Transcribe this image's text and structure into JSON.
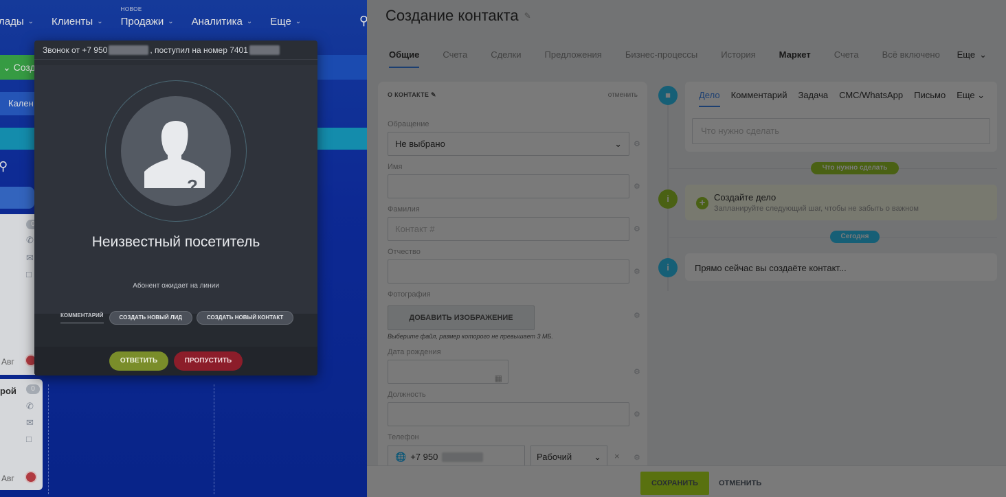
{
  "left_crm": {
    "nav": [
      {
        "label": "лады",
        "badge": ""
      },
      {
        "label": "Клиенты",
        "badge": ""
      },
      {
        "label": "Продажи",
        "badge": "НОВОЕ"
      },
      {
        "label": "Аналитика",
        "badge": ""
      },
      {
        "label": "Еще",
        "badge": ""
      }
    ],
    "create_button": "Созда",
    "calendar_button": "Кален",
    "cards": [
      {
        "count": "0",
        "date": "Авг",
        "name": ""
      },
      {
        "count": "0",
        "date": "Авг",
        "name": "рой"
      }
    ]
  },
  "call_popup": {
    "header_prefix": "Звонок от +7 950",
    "header_middle": ", поступил на номер 7401",
    "visitor_name": "Неизвестный посетитель",
    "waiting_text": "Абонент ожидает на линии",
    "comment_tab": "КОММЕНТАРИЙ",
    "new_lead_button": "СОЗДАТЬ НОВЫЙ ЛИД",
    "new_contact_button": "СОЗДАТЬ НОВЫЙ КОНТАКТ",
    "answer_button": "ОТВЕТИТЬ",
    "skip_button": "ПРОПУСТИТЬ"
  },
  "contact_form": {
    "title": "Создание контакта",
    "tabs": [
      "Общие",
      "Счета",
      "Сделки",
      "Предложения",
      "Бизнес-процессы",
      "История",
      "Маркет",
      "Счета",
      "Всё включено"
    ],
    "tabs_more": "Еще",
    "section_title": "О КОНТАКТЕ",
    "section_cancel": "отменить",
    "fields": {
      "salutation_label": "Обращение",
      "salutation_value": "Не выбрано",
      "name_label": "Имя",
      "lastname_label": "Фамилия",
      "lastname_placeholder": "Контакт #",
      "middlename_label": "Отчество",
      "photo_label": "Фотография",
      "add_image_button": "ДОБАВИТЬ ИЗОБРАЖЕНИЕ",
      "photo_hint": "Выберите файл, размер которого не превышает 3 МБ.",
      "birthdate_label": "Дата рождения",
      "position_label": "Должность",
      "phone_label": "Телефон",
      "phone_value": "+7 950",
      "phone_type": "Рабочий"
    }
  },
  "timeline": {
    "tabs": [
      "Дело",
      "Комментарий",
      "Задача",
      "СМС/WhatsApp",
      "Письмо",
      "Еще"
    ],
    "todo_placeholder": "Что нужно сделать",
    "todo_badge": "Что нужно сделать",
    "create_task_title": "Создайте дело",
    "create_task_sub": "Запланируйте следующий шаг, чтобы не забыть о важном",
    "today_badge": "Сегодня",
    "creating_text": "Прямо сейчас вы создаёте контакт..."
  },
  "bottom_bar": {
    "save": "СОХРАНИТЬ",
    "cancel": "ОТМЕНИТЬ"
  },
  "colors": {
    "accent_blue": "#3b84ec",
    "save_green": "#bbed21",
    "answer_green": "#7a8d2a",
    "skip_red": "#8c1d2a",
    "timeline_lime": "#9ccb2b",
    "timeline_teal": "#2fc6f6"
  }
}
